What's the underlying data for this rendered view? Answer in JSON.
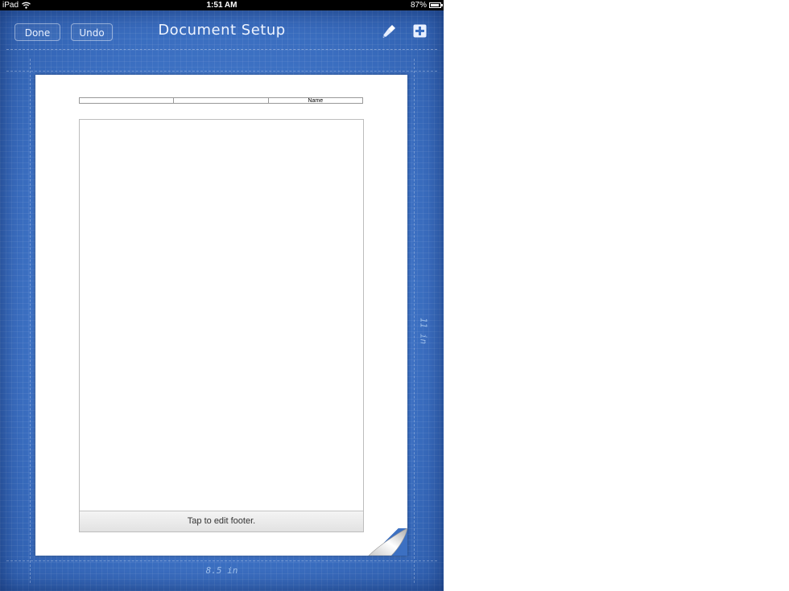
{
  "status_bar": {
    "device": "iPad",
    "time": "1:51 AM",
    "battery": "87%",
    "battery_level": 0.87
  },
  "toolbar": {
    "done_label": "Done",
    "undo_label": "Undo",
    "title": "Document Setup",
    "brush_icon": "paintbrush-icon",
    "add_icon": "plus-icon"
  },
  "document": {
    "header_cells": [
      "",
      "",
      "Name"
    ],
    "footer_label": "Tap to edit footer."
  },
  "dimensions": {
    "width": "8.5 in",
    "height": "11 in"
  },
  "colors": {
    "blueprint": "#3c70c2",
    "paper": "#ffffff"
  }
}
